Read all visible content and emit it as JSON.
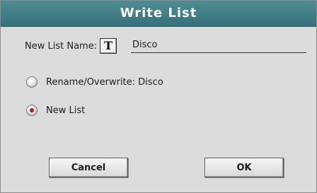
{
  "dialog": {
    "title": "Write List",
    "name_label": "New List Name:",
    "name_icon_glyph": "T",
    "name_value": "Disco",
    "options": [
      {
        "label": "Rename/Overwrite: Disco",
        "selected": false
      },
      {
        "label": "New List",
        "selected": true
      }
    ],
    "cancel_label": "Cancel",
    "ok_label": "OK"
  },
  "colors": {
    "titlebar": "#3e7e87",
    "background": "#dcdcdc",
    "radio_selected": "#b01818"
  }
}
